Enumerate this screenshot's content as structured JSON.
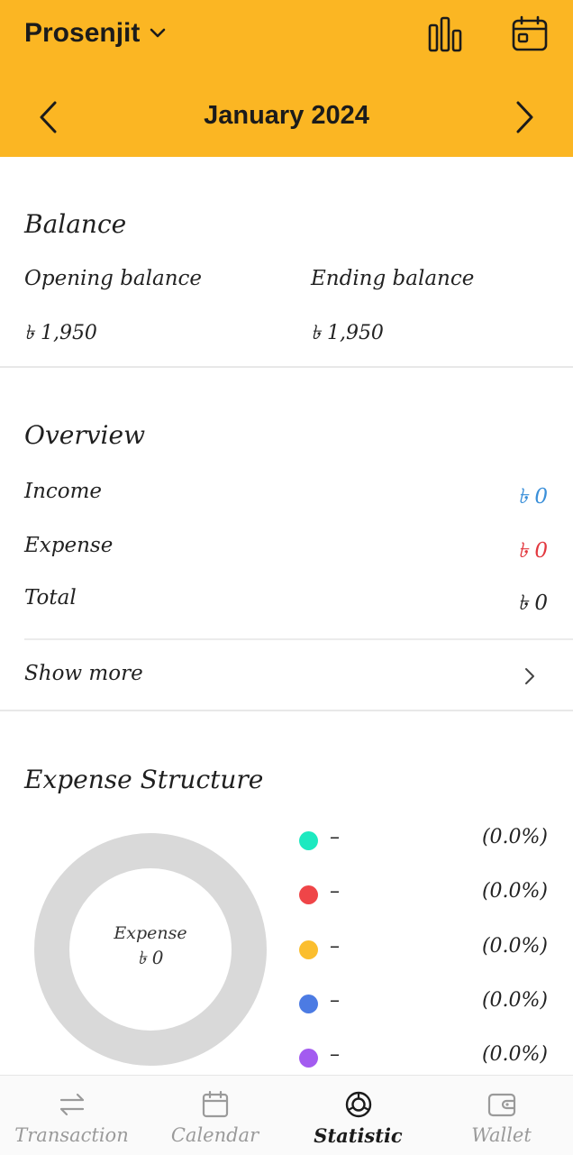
{
  "header": {
    "account_name": "Prosenjit",
    "month_label": "January 2024",
    "icons": [
      "chevron-down-icon",
      "bar-chart-icon",
      "calendar-icon",
      "chevron-left-icon",
      "chevron-right-icon"
    ]
  },
  "balance": {
    "title": "Balance",
    "opening_label": "Opening balance",
    "opening_value": "৳ 1,950",
    "ending_label": "Ending balance",
    "ending_value": "৳ 1,950"
  },
  "overview": {
    "title": "Overview",
    "income_label": "Income",
    "income_value": "৳ 0",
    "expense_label": "Expense",
    "expense_value": "৳ 0",
    "total_label": "Total",
    "total_value": "৳ 0",
    "show_more_label": "Show more"
  },
  "expense_structure": {
    "title": "Expense Structure",
    "center_label": "Expense",
    "center_value": "৳ 0",
    "legend": [
      {
        "name": "–",
        "percent": "(0.0%)",
        "color": "#1DE9C0"
      },
      {
        "name": "–",
        "percent": "(0.0%)",
        "color": "#EF4548"
      },
      {
        "name": "–",
        "percent": "(0.0%)",
        "color": "#FBBE2E"
      },
      {
        "name": "–",
        "percent": "(0.0%)",
        "color": "#4C7BE3"
      },
      {
        "name": "–",
        "percent": "(0.0%)",
        "color": "#A35BF0"
      }
    ]
  },
  "bottom_nav": {
    "items": [
      {
        "label": "Transaction",
        "icon": "transfer-icon",
        "active": false
      },
      {
        "label": "Calendar",
        "icon": "calendar-icon",
        "active": false
      },
      {
        "label": "Statistic",
        "icon": "statistic-icon",
        "active": true
      },
      {
        "label": "Wallet",
        "icon": "wallet-icon",
        "active": false
      }
    ]
  },
  "colors": {
    "header_bg": "#FBB623",
    "income": "#3A8FD9",
    "expense": "#E2383F",
    "donut_empty": "#D9D9D9"
  }
}
